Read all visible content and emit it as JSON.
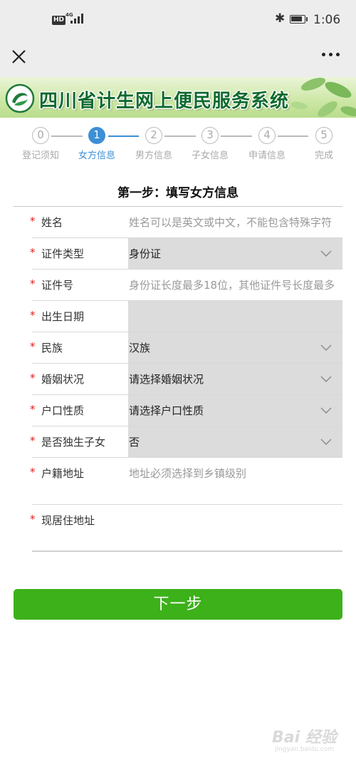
{
  "status_bar": {
    "hd": "HD",
    "network": "4G",
    "time": "1:06"
  },
  "nav": {
    "close_icon": "close-icon",
    "more_icon": "more-icon"
  },
  "banner": {
    "title": "四川省计生网上便民服务系统"
  },
  "steps": [
    {
      "num": "0",
      "label": "登记须知",
      "active": false
    },
    {
      "num": "1",
      "label": "女方信息",
      "active": true
    },
    {
      "num": "2",
      "label": "男方信息",
      "active": false
    },
    {
      "num": "3",
      "label": "子女信息",
      "active": false
    },
    {
      "num": "4",
      "label": "申请信息",
      "active": false
    },
    {
      "num": "5",
      "label": "完成",
      "active": false
    }
  ],
  "page_heading": "第一步：填写女方信息",
  "form": {
    "required_mark": "*",
    "fields": [
      {
        "label": "姓名",
        "type": "text",
        "value": "",
        "placeholder": "姓名可以是英文或中文，不能包含特殊字符"
      },
      {
        "label": "证件类型",
        "type": "select",
        "value": "身份证"
      },
      {
        "label": "证件号",
        "type": "text",
        "value": "",
        "placeholder": "身份证长度最多18位，其他证件号长度最多"
      },
      {
        "label": "出生日期",
        "type": "date",
        "value": ""
      },
      {
        "label": "民族",
        "type": "select",
        "value": "汉族"
      },
      {
        "label": "婚姻状况",
        "type": "select",
        "value": "请选择婚姻状况"
      },
      {
        "label": "户口性质",
        "type": "select",
        "value": "请选择户口性质"
      },
      {
        "label": "是否独生子女",
        "type": "select",
        "value": "否"
      },
      {
        "label": "户籍地址",
        "type": "textarea",
        "value": "",
        "placeholder": "地址必须选择到乡镇级别"
      },
      {
        "label": "现居住地址",
        "type": "textarea",
        "value": "",
        "placeholder": ""
      }
    ]
  },
  "next_button": "下一步",
  "watermark": {
    "text": "Bai 经验",
    "url": "jingyan.baidu.com"
  },
  "colors": {
    "accent_blue": "#3d8fd6",
    "button_green": "#3cb11a",
    "required_red": "#e0201c",
    "banner_title": "#0e6a2d"
  }
}
